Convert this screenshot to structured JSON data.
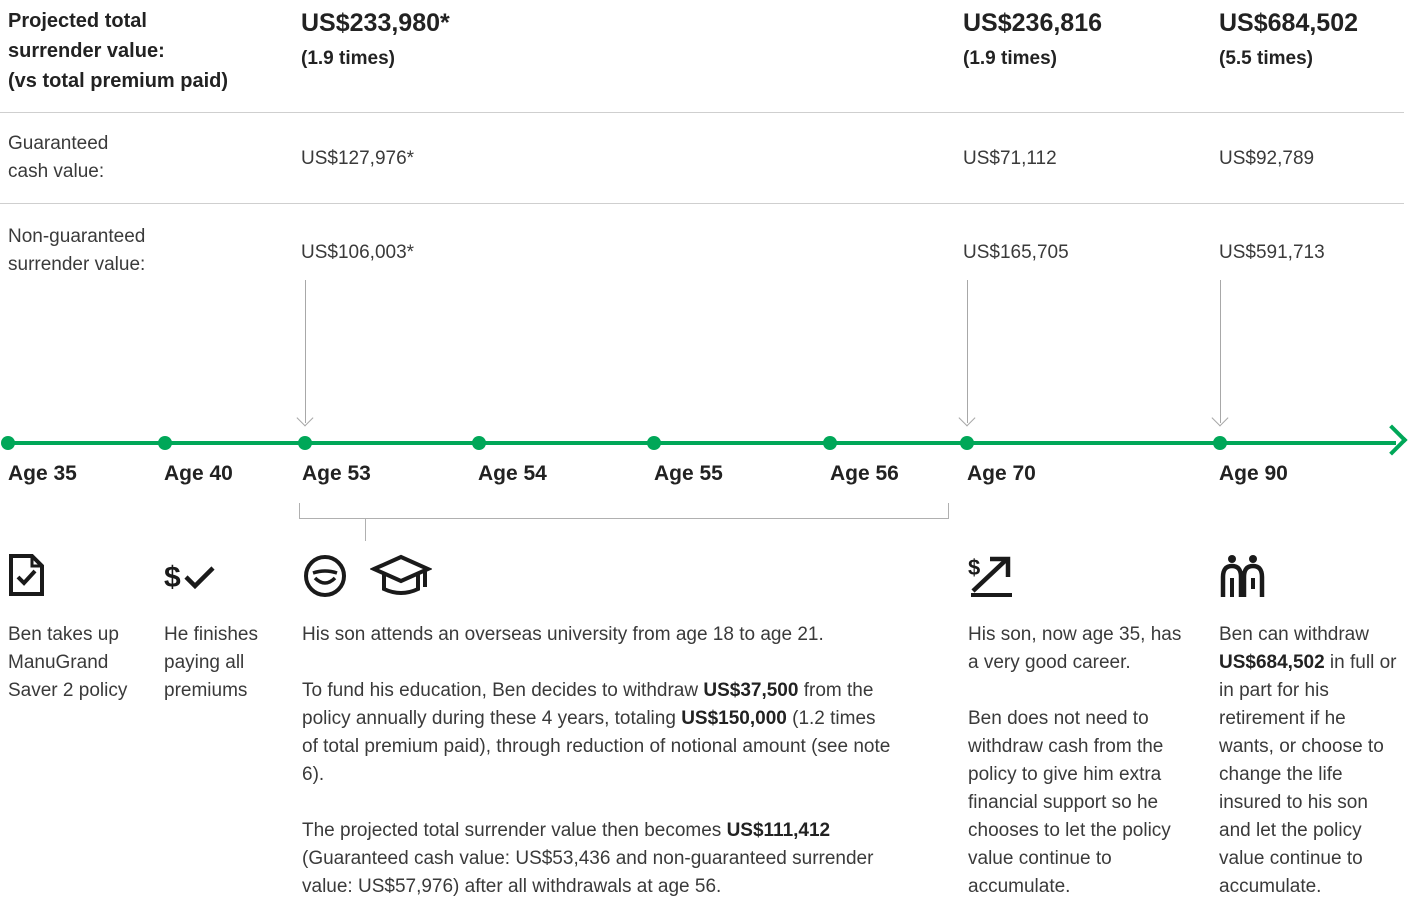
{
  "header": {
    "label_line1": "Projected total",
    "label_line2": "surrender value:",
    "label_line3": "(vs total premium paid)",
    "col1_total": "US$233,980*",
    "col1_times": "(1.9 times)",
    "col2_total": "US$236,816",
    "col2_times": "(1.9 times)",
    "col3_total": "US$684,502",
    "col3_times": "(5.5 times)"
  },
  "guaranteed": {
    "label_line1": "Guaranteed",
    "label_line2": "cash value:",
    "col1": "US$127,976*",
    "col2": "US$71,112",
    "col3": "US$92,789"
  },
  "non_guaranteed": {
    "label_line1": "Non-guaranteed",
    "label_line2": "surrender value:",
    "col1": "US$106,003*",
    "col2": "US$165,705",
    "col3": "US$591,713"
  },
  "timeline": {
    "ages": [
      "Age 35",
      "Age 40",
      "Age 53",
      "Age 54",
      "Age 55",
      "Age 56",
      "Age 70",
      "Age 90"
    ],
    "accent_color": "#00a758"
  },
  "events": {
    "age35": {
      "icon": "document-check-icon",
      "lines": [
        "Ben takes up",
        "ManuGrand",
        "Saver 2 policy"
      ]
    },
    "age40": {
      "icon": "dollar-check-icon",
      "lines": [
        "He finishes",
        "paying all",
        "premiums"
      ]
    },
    "age53": {
      "icons": [
        "smiley-face-icon",
        "graduation-cap-icon"
      ],
      "p1": "His son attends an overseas university from age 18 to age 21.",
      "p2_a": "To fund his education, Ben decides to withdraw ",
      "p2_b": "US$37,500",
      "p2_c": " from the policy annually during these 4 years, totaling ",
      "p2_d": "US$150,000",
      "p2_e": " (1.2 times of total premium paid), through reduction of notional amount (see note 6).",
      "p3_a": "The projected total surrender value then becomes ",
      "p3_b": "US$111,412",
      "p3_c": " (Guaranteed cash value: US$53,436 and non-guaranteed surrender value: US$57,976) after all withdrawals at age 56."
    },
    "age70": {
      "icon": "dollar-growth-arrow-icon",
      "p1": "His son, now age 35, has a very good career.",
      "p2": "Ben does not need to withdraw cash from the policy to give him extra financial support so he chooses to let the policy value continue to accumulate."
    },
    "age90": {
      "icon": "parent-child-icon",
      "p_a": "Ben can withdraw ",
      "p_b": "US$684,502",
      "p_c": " in full or in part for his retirement if he wants, or choose to change the life insured to his son and let the policy value continue to accumulate."
    }
  }
}
